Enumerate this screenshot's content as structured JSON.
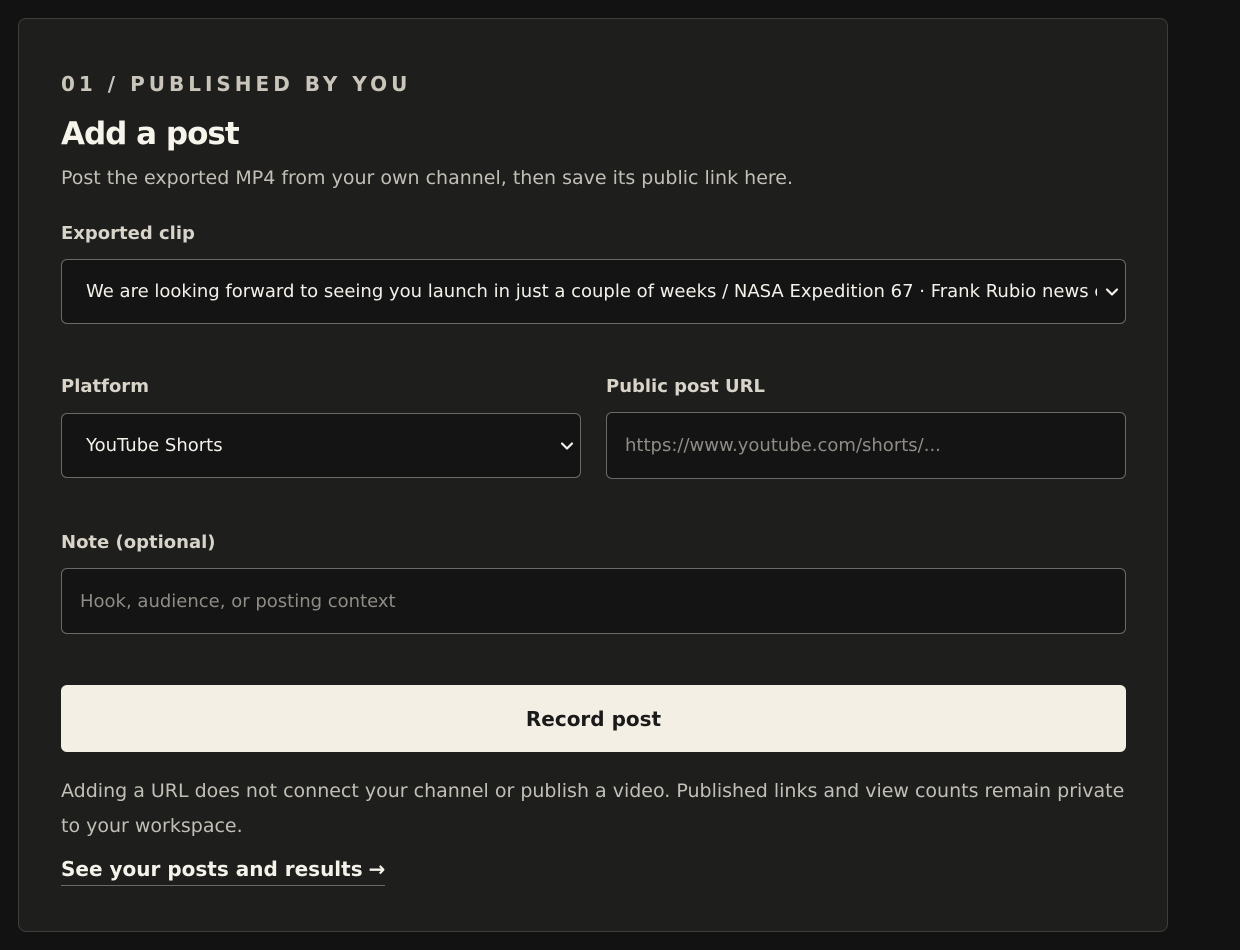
{
  "card": {
    "eyebrow": "01 / PUBLISHED BY YOU",
    "title": "Add a post",
    "subtitle": "Post the exported MP4 from your own channel, then save its public link here."
  },
  "clip": {
    "label": "Exported clip",
    "selected": "We are looking forward to seeing you launch in just a couple of weeks / NASA Expedition 67 · Frank Rubio news conferen"
  },
  "platform": {
    "label": "Platform",
    "selected": "YouTube Shorts"
  },
  "url": {
    "label": "Public post URL",
    "placeholder": "https://www.youtube.com/shorts/..."
  },
  "note": {
    "label": "Note (optional)",
    "placeholder": "Hook, audience, or posting context"
  },
  "actions": {
    "record_label": "Record post",
    "disclaimer": "Adding a URL does not connect your channel or publish a video. Published links and view counts remain private to your workspace.",
    "results_link": "See your posts and results",
    "results_link_arrow": "→"
  },
  "icons": {
    "select_chevron": "chevron-down-icon",
    "link_arrow": "arrow-right-icon"
  },
  "colors": {
    "background": "#121212",
    "card": "#1e1e1d",
    "field": "#141414",
    "field_border": "#6b6a66",
    "primary_button": "#f3efe4",
    "text": "#f2efe7",
    "muted_text": "#c2bfb7"
  }
}
